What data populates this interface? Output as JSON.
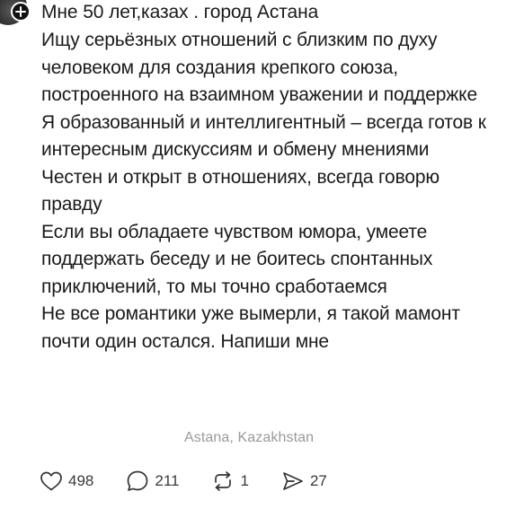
{
  "post": {
    "author_line": "Мне 50 лет,казах . город Астана",
    "paragraphs": [
      "Ищу серьёзных отношений с близким по духу человеком для создания крепкого союза, построенного на взаимном уважении и поддержке",
      "Я образованный и интеллигентный – всегда готов к интересным дискуссиям и обмену мнениями",
      "Честен и открыт в отношениях, всегда говорю правду",
      "Если вы обладаете чувством юмора, умеете поддержать беседу и не боитесь спонтанных приключений, то мы точно сработаемся",
      "Не все романтики уже вымерли, я такой мамонт почти один остался. Напиши мне"
    ],
    "location": "Astana, Kazakhstan"
  },
  "actions": {
    "likes": "498",
    "comments": "211",
    "reposts": "1",
    "shares": "27"
  },
  "icons": {
    "like": "heart-icon",
    "comment": "comment-bubble-icon",
    "repost": "repost-icon",
    "share": "send-icon",
    "follow": "plus-icon"
  }
}
